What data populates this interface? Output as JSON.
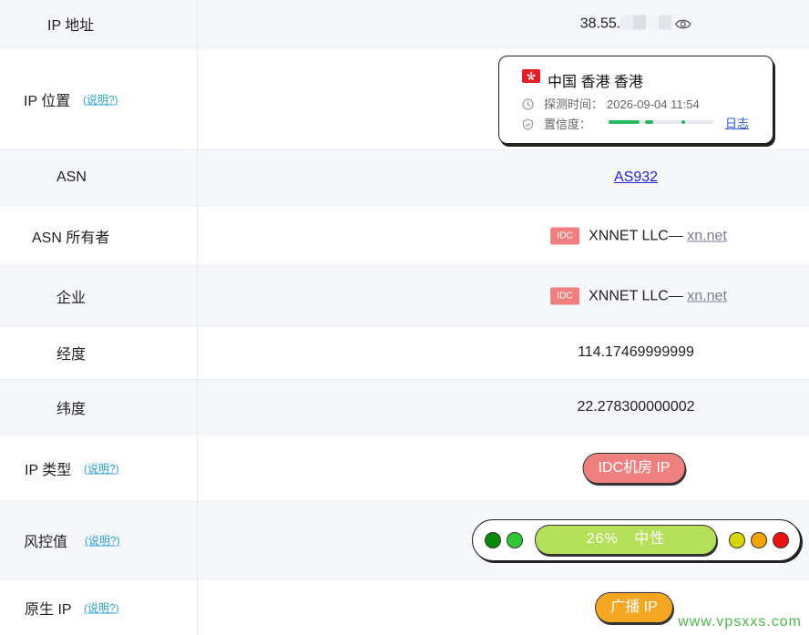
{
  "rows": {
    "ip": {
      "label": "IP 地址",
      "value_prefix": "38.55."
    },
    "location": {
      "label": "IP 位置",
      "explain": "(说明?)",
      "card": {
        "title": "中国 香港 香港",
        "detect_label": "探测时间：",
        "detect_time": "2026-09-04 11:54",
        "confidence_label": "置信度：",
        "log_link": "日志"
      }
    },
    "asn": {
      "label": "ASN",
      "value": "AS932"
    },
    "asn_owner": {
      "label": "ASN 所有者",
      "tag": "IDC",
      "name": "XNNET LLC—",
      "domain": "xn.net"
    },
    "company": {
      "label": "企业",
      "tag": "IDC",
      "name": "XNNET LLC—",
      "domain": "xn.net"
    },
    "longitude": {
      "label": "经度",
      "value": "114.17469999999"
    },
    "latitude": {
      "label": "纬度",
      "value": "22.278300000002"
    },
    "ip_type": {
      "label": "IP 类型",
      "explain": "(说明?)",
      "value": "IDC机房 IP"
    },
    "risk": {
      "label": "风控值",
      "explain": "(说明?)",
      "percent": "26%",
      "level": "中性"
    },
    "native_ip": {
      "label": "原生 IP",
      "explain": "(说明?)",
      "value": "广播 IP"
    }
  },
  "watermark": "www.vpsxxs.com",
  "colors": {
    "idc_pill": "#f08080",
    "broadcast_pill": "#f5a623",
    "risk_bar": "#b5e05a",
    "link": "#1f1fd6",
    "explain": "#2aa3d8",
    "flag": "#e41e26",
    "confidence": "#27b862"
  },
  "icons": [
    "eye-icon",
    "hk-flag-icon",
    "clock-icon",
    "shield-check-icon"
  ]
}
